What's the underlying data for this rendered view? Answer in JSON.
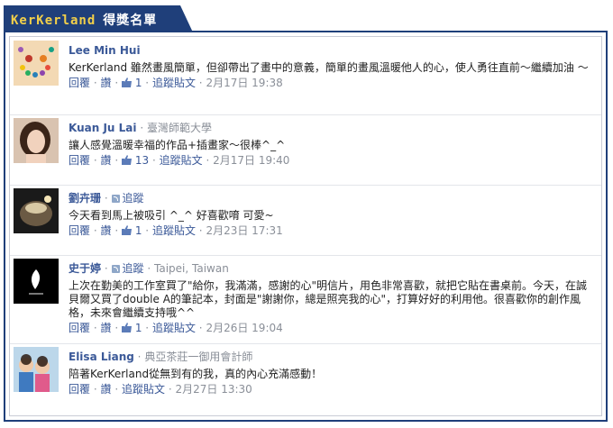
{
  "header": {
    "brand": "KerKerland",
    "title": "得獎名單"
  },
  "actions": {
    "reply": "回覆",
    "like": "讚",
    "follow_post": "追蹤貼文",
    "sep": "·"
  },
  "comments": [
    {
      "name": "Lee Min Hui",
      "text": "KerKerland 雖然畫風簡單，但卻帶出了畫中的意義，簡單的畫風溫暖他人的心，使人勇往直前～繼續加油 ～",
      "likes": "1",
      "time": "2月17日 19:38"
    },
    {
      "name": "Kuan Ju Lai",
      "sub": "臺灣師範大學",
      "text": "讓人感覺溫暖幸福的作品+插畫家～很棒^_^",
      "likes": "13",
      "time": "2月17日 19:40"
    },
    {
      "name": "劉卉珊",
      "follow": "追蹤",
      "text": "今天看到馬上被吸引 ^_^ 好喜歡唷 可愛~",
      "likes": "1",
      "time": "2月23日 17:31"
    },
    {
      "name": "史于婷",
      "follow": "追蹤",
      "sub": "Taipei, Taiwan",
      "text": "上次在勤美的工作室買了\"給你，我滿滿，感謝的心\"明信片，用色非常喜歡，就把它貼在書桌前。今天，在誠貝爾又買了double A的筆記本，封面是\"謝謝你，總是照亮我的心\"，打算好好的利用他。很喜歡你的創作風格，未來會繼續支持哦^^",
      "likes": "1",
      "time": "2月26日 19:04"
    },
    {
      "name": "Elisa Liang",
      "sub": "典亞茶莊一御用會計師",
      "text": "陪著KerKerland從無到有的我，真的內心充滿感動！",
      "time": "2月27日 13:30"
    }
  ]
}
